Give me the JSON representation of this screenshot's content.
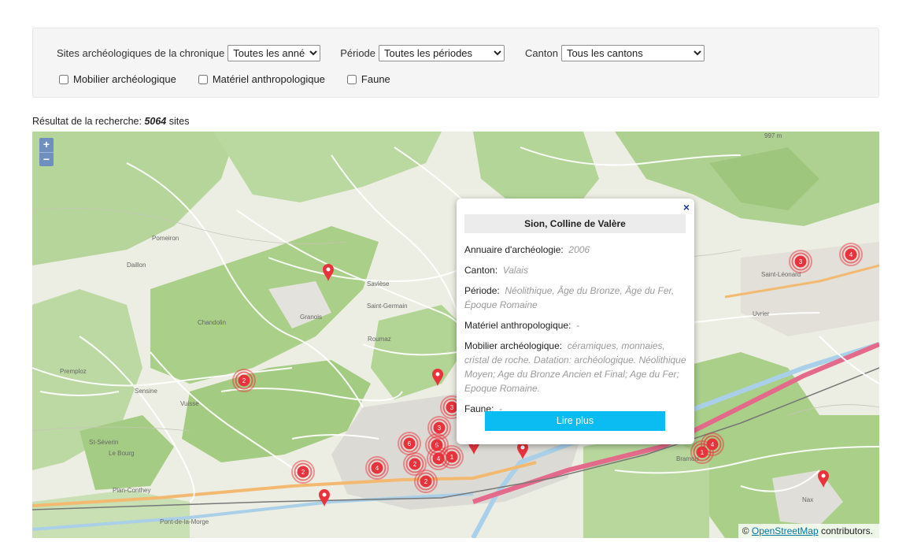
{
  "filters": {
    "sites_label": "Sites archéologiques de la chronique",
    "year_value": "Toutes les années",
    "period_label": "Période",
    "period_value": "Toutes les périodes",
    "canton_label": "Canton",
    "canton_value": "Tous les cantons",
    "checkboxes": [
      {
        "label": "Mobilier archéologique",
        "checked": false
      },
      {
        "label": "Matériel anthropologique",
        "checked": false
      },
      {
        "label": "Faune",
        "checked": false
      }
    ]
  },
  "result": {
    "prefix": "Résultat de la recherche:",
    "count": "5064",
    "suffix": "sites"
  },
  "map": {
    "zoom_in": "+",
    "zoom_out": "−",
    "attribution_prefix": "©",
    "attribution_link": "OpenStreetMap",
    "attribution_suffix": "contributors.",
    "place_labels": [
      "Pomeiron",
      "Daillon",
      "Chandolin",
      "Premploz",
      "Sensine",
      "St-Séverin",
      "Le Bourg",
      "Vuisse",
      "Plan-Conthey",
      "Pont-de-la-Morge",
      "Granois",
      "Saint-Germain",
      "Roumaz",
      "Savièse",
      "Saint-Léonard",
      "Uvrier",
      "Bramois",
      "Nax",
      "997 m"
    ],
    "clusters": [
      "2",
      "2",
      "4",
      "6",
      "3",
      "5",
      "4",
      "1",
      "2",
      "2",
      "3",
      "1",
      "4",
      "3",
      "4"
    ],
    "popup": {
      "close": "×",
      "title": "Sion, Colline de Valère",
      "fields": [
        {
          "label": "Annuaire d'archéologie:",
          "value": "2006"
        },
        {
          "label": "Canton:",
          "value": "Valais"
        },
        {
          "label": "Période:",
          "value": "Néolithique, Âge du Bronze, Âge du Fer, Époque Romaine"
        },
        {
          "label": "Matériel anthropologique:",
          "value": "-"
        },
        {
          "label": "Mobilier archéologique:",
          "value": "céramiques, monnaies, cristal de roche. Datation: archéologique. Néolithique Moyen; Age du Bronze Ancien et Final; Age du Fer; Epoque Romaine."
        },
        {
          "label": "Faune:",
          "value": "-"
        }
      ],
      "button": "Lire plus"
    }
  },
  "colors": {
    "button": "#0bbcf2",
    "cluster": "#e8333d",
    "marker": "#e8333d",
    "forest": "#a7cf85",
    "zoom": "#6f8fbf"
  }
}
